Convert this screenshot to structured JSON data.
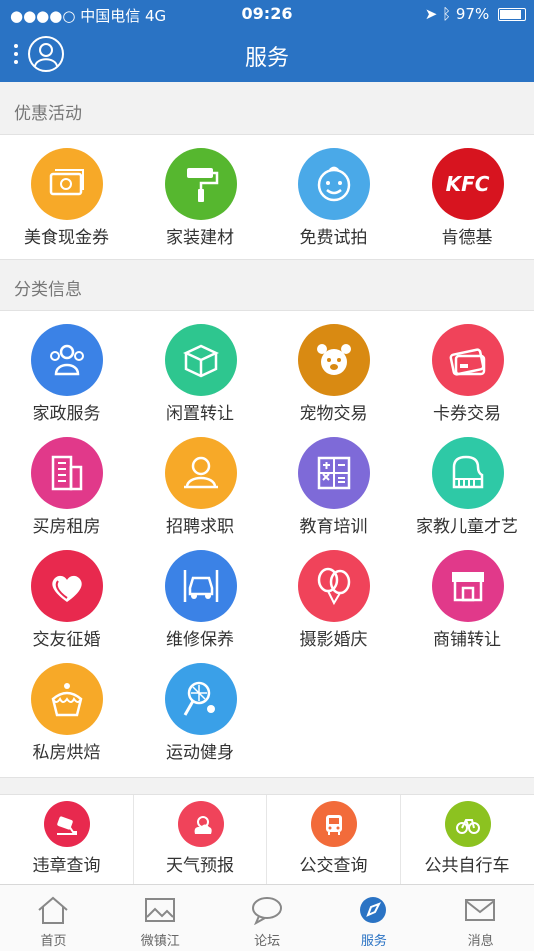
{
  "status_bar": {
    "carrier": "●●●●○ 中国电信  4G",
    "time": "09:26",
    "battery": "97%"
  },
  "nav": {
    "title": "服务"
  },
  "sections": [
    {
      "title": "优惠活动"
    },
    {
      "title": "分类信息"
    }
  ],
  "promotions": [
    {
      "label": "美食现金券",
      "color": "#f7a928",
      "icon": "cash-icon"
    },
    {
      "label": "家装建材",
      "color": "#56b72f",
      "icon": "paint-roller-icon"
    },
    {
      "label": "免费试拍",
      "color": "#4aa9e8",
      "icon": "baby-face-icon"
    },
    {
      "label": "肯德基",
      "color": "#d7141f",
      "icon": "kfc-logo-icon",
      "logo_text": "KFC"
    }
  ],
  "categories": [
    {
      "label": "家政服务",
      "color": "#3b82e6",
      "icon": "people-icon"
    },
    {
      "label": "闲置转让",
      "color": "#2ec68f",
      "icon": "box-icon"
    },
    {
      "label": "宠物交易",
      "color": "#d98a12",
      "icon": "dog-icon"
    },
    {
      "label": "卡券交易",
      "color": "#f0435a",
      "icon": "card-icon"
    },
    {
      "label": "买房租房",
      "color": "#e1398a",
      "icon": "building-icon"
    },
    {
      "label": "招聘求职",
      "color": "#f7a928",
      "icon": "person-icon"
    },
    {
      "label": "教育培训",
      "color": "#7e6ad8",
      "icon": "calculator-icon"
    },
    {
      "label": "家教儿童才艺",
      "color": "#2ec9a6",
      "icon": "piano-icon"
    },
    {
      "label": "交友征婚",
      "color": "#e8294e",
      "icon": "heart-icon"
    },
    {
      "label": "维修保养",
      "color": "#3b82e6",
      "icon": "car-lift-icon"
    },
    {
      "label": "摄影婚庆",
      "color": "#f0435a",
      "icon": "balloons-icon"
    },
    {
      "label": "商铺转让",
      "color": "#e1398a",
      "icon": "shop-icon"
    },
    {
      "label": "私房烘焙",
      "color": "#f7a928",
      "icon": "cake-icon"
    },
    {
      "label": "运动健身",
      "color": "#3aa0e8",
      "icon": "badminton-icon"
    }
  ],
  "tools": [
    {
      "label": "违章查询",
      "color": "#e8294e",
      "icon": "camera-icon"
    },
    {
      "label": "天气预报",
      "color": "#f0435a",
      "icon": "weather-icon"
    },
    {
      "label": "公交查询",
      "color": "#f26b3a",
      "icon": "bus-icon"
    },
    {
      "label": "公共自行车",
      "color": "#8cc220",
      "icon": "bicycle-icon"
    }
  ],
  "tabs": [
    {
      "label": "首页",
      "icon": "home-icon",
      "active": false
    },
    {
      "label": "微镇江",
      "icon": "image-icon",
      "active": false
    },
    {
      "label": "论坛",
      "icon": "chat-icon",
      "active": false
    },
    {
      "label": "服务",
      "icon": "compass-icon",
      "active": true
    },
    {
      "label": "消息",
      "icon": "mail-icon",
      "active": false
    }
  ]
}
